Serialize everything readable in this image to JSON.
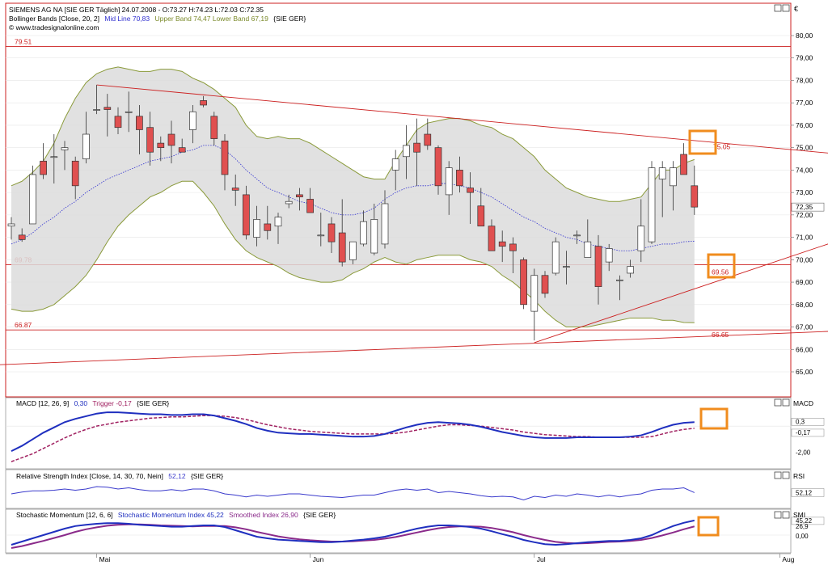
{
  "main": {
    "header_line1": "SIEMENS AG NA [SIE GER  Täglich] 24.07.2008 - O:73.27 H:74.23 L:72.03 C:72.35",
    "header_line2_a": "Bollinger Bands [Close, 20, 2]",
    "header_line2_b": "Mid Line 70,83",
    "header_line2_c": "Upper Band 74,47 Lower Band 67,19",
    "header_line2_d": "{SIE GER}",
    "source": "© www.tradesignalonline.com",
    "currency": "€",
    "y_ticks": [
      65,
      66,
      67,
      68,
      69,
      70,
      71,
      72,
      73,
      74,
      75,
      76,
      77,
      78,
      79,
      80
    ],
    "last_price": "72.35",
    "levels": [
      {
        "value": 79.51,
        "label": "79.51",
        "side": "left"
      },
      {
        "value": 69.78,
        "label": "69.78",
        "side": "left"
      },
      {
        "value": 66.87,
        "label": "66.87",
        "side": "left"
      }
    ],
    "trend_labels": [
      {
        "label": "75.05"
      },
      {
        "label": "69.56"
      },
      {
        "label": "66.65"
      }
    ]
  },
  "macd": {
    "title_a": "MACD [12, 26, 9]",
    "title_b": "0,30",
    "title_c": "Trigger -0,17",
    "title_d": "{SIE GER}",
    "axis_name": "MACD",
    "ticks": [
      "0,3",
      "-0,17",
      "-2,00"
    ]
  },
  "rsi": {
    "title_a": "Relative Strength Index [Close, 14, 30, 70, Nein]",
    "title_b": "52,12",
    "title_c": "{SIE GER}",
    "axis_name": "RSI",
    "tick": "52,12"
  },
  "smi": {
    "title_a": "Stochastic Momentum [12, 6, 6]",
    "title_b": "Stochastic Momentum Index 45,22",
    "title_c": "Smoothed Index 26,90",
    "title_d": "{SIE GER}",
    "axis_name": "SMI",
    "ticks": [
      "45,22",
      "26,9",
      "0,00"
    ]
  },
  "x_labels": [
    "Mai",
    "Jun",
    "Jul",
    "Aug"
  ],
  "colors": {
    "bull": "#ffffff",
    "bear": "#e05050",
    "band_fill": "#dcdcdc",
    "band_line": "#8a9a3a",
    "mid_line": "#3030d0",
    "level_line": "#cc2020",
    "highlight": "#f08c1e",
    "macd_line": "#1f2fbf",
    "trigger_line": "#a02060",
    "rsi_line": "#3a3acc",
    "smi_line": "#1f2fbf",
    "smi_smooth": "#8a2a8a"
  },
  "chart_data": {
    "type": "candlestick",
    "ylim": [
      64.3,
      80.9
    ],
    "candles": [
      {
        "o": 71.5,
        "h": 71.9,
        "l": 70.9,
        "c": 71.6
      },
      {
        "o": 71.1,
        "h": 71.4,
        "l": 70.8,
        "c": 70.9
      },
      {
        "o": 71.6,
        "h": 74.2,
        "l": 71.6,
        "c": 73.8
      },
      {
        "o": 74.4,
        "h": 75.2,
        "l": 73.6,
        "c": 73.8
      },
      {
        "o": 74.6,
        "h": 75.6,
        "l": 73.4,
        "c": 74.6
      },
      {
        "o": 74.9,
        "h": 75.3,
        "l": 74.0,
        "c": 75.0
      },
      {
        "o": 74.4,
        "h": 74.6,
        "l": 72.7,
        "c": 73.3
      },
      {
        "o": 74.5,
        "h": 76.6,
        "l": 74.3,
        "c": 75.6
      },
      {
        "o": 76.7,
        "h": 77.8,
        "l": 76.5,
        "c": 76.7
      },
      {
        "o": 76.8,
        "h": 77.4,
        "l": 75.5,
        "c": 76.7
      },
      {
        "o": 76.4,
        "h": 76.8,
        "l": 75.6,
        "c": 75.9
      },
      {
        "o": 76.6,
        "h": 77.5,
        "l": 75.7,
        "c": 76.6
      },
      {
        "o": 76.4,
        "h": 76.9,
        "l": 74.7,
        "c": 75.8
      },
      {
        "o": 75.9,
        "h": 76.6,
        "l": 74.2,
        "c": 74.8
      },
      {
        "o": 75.2,
        "h": 75.5,
        "l": 74.4,
        "c": 75.0
      },
      {
        "o": 75.6,
        "h": 76.2,
        "l": 74.3,
        "c": 75.1
      },
      {
        "o": 75.0,
        "h": 75.4,
        "l": 74.8,
        "c": 74.8
      },
      {
        "o": 75.8,
        "h": 76.9,
        "l": 75.2,
        "c": 76.6
      },
      {
        "o": 77.1,
        "h": 77.3,
        "l": 76.8,
        "c": 76.9
      },
      {
        "o": 76.4,
        "h": 76.6,
        "l": 75.1,
        "c": 75.4
      },
      {
        "o": 75.3,
        "h": 75.6,
        "l": 73.1,
        "c": 73.8
      },
      {
        "o": 73.2,
        "h": 73.8,
        "l": 72.4,
        "c": 73.1
      },
      {
        "o": 72.9,
        "h": 73.3,
        "l": 70.9,
        "c": 71.1
      },
      {
        "o": 71.0,
        "h": 72.4,
        "l": 70.6,
        "c": 71.8
      },
      {
        "o": 71.6,
        "h": 72.4,
        "l": 70.9,
        "c": 71.3
      },
      {
        "o": 71.5,
        "h": 72.1,
        "l": 70.7,
        "c": 71.9
      },
      {
        "o": 72.5,
        "h": 72.9,
        "l": 72.3,
        "c": 72.6
      },
      {
        "o": 72.9,
        "h": 73.2,
        "l": 72.2,
        "c": 72.8
      },
      {
        "o": 72.7,
        "h": 73.2,
        "l": 72.5,
        "c": 72.1
      },
      {
        "o": 71.1,
        "h": 72.1,
        "l": 70.6,
        "c": 71.1
      },
      {
        "o": 71.6,
        "h": 71.9,
        "l": 70.3,
        "c": 70.8
      },
      {
        "o": 71.2,
        "h": 72.7,
        "l": 69.7,
        "c": 69.9
      },
      {
        "o": 70.0,
        "h": 70.8,
        "l": 69.8,
        "c": 70.8
      },
      {
        "o": 70.7,
        "h": 72.2,
        "l": 70.6,
        "c": 71.7
      },
      {
        "o": 70.3,
        "h": 72.5,
        "l": 70.2,
        "c": 71.8
      },
      {
        "o": 70.7,
        "h": 73.1,
        "l": 70.5,
        "c": 72.5
      },
      {
        "o": 74.0,
        "h": 74.9,
        "l": 73.1,
        "c": 74.5
      },
      {
        "o": 74.6,
        "h": 76.0,
        "l": 73.6,
        "c": 75.1
      },
      {
        "o": 75.2,
        "h": 76.3,
        "l": 73.3,
        "c": 74.8
      },
      {
        "o": 75.6,
        "h": 76.3,
        "l": 74.9,
        "c": 75.1
      },
      {
        "o": 75.0,
        "h": 75.1,
        "l": 72.9,
        "c": 73.3
      },
      {
        "o": 72.9,
        "h": 74.4,
        "l": 72.0,
        "c": 74.1
      },
      {
        "o": 74.0,
        "h": 74.6,
        "l": 73.0,
        "c": 73.3
      },
      {
        "o": 73.2,
        "h": 73.9,
        "l": 71.6,
        "c": 73.0
      },
      {
        "o": 72.4,
        "h": 73.2,
        "l": 71.5,
        "c": 71.5
      },
      {
        "o": 71.5,
        "h": 71.8,
        "l": 70.4,
        "c": 70.4
      },
      {
        "o": 70.8,
        "h": 71.3,
        "l": 69.9,
        "c": 70.6
      },
      {
        "o": 70.7,
        "h": 71.0,
        "l": 69.4,
        "c": 70.4
      },
      {
        "o": 70.0,
        "h": 70.1,
        "l": 67.8,
        "c": 68.0
      },
      {
        "o": 67.7,
        "h": 69.6,
        "l": 66.4,
        "c": 69.3
      },
      {
        "o": 69.3,
        "h": 69.5,
        "l": 68.3,
        "c": 68.5
      },
      {
        "o": 69.4,
        "h": 71.0,
        "l": 69.3,
        "c": 70.8
      },
      {
        "o": 69.7,
        "h": 70.4,
        "l": 68.9,
        "c": 69.7
      },
      {
        "o": 71.1,
        "h": 71.3,
        "l": 70.7,
        "c": 71.1
      },
      {
        "o": 70.1,
        "h": 71.8,
        "l": 70.1,
        "c": 70.8
      },
      {
        "o": 70.6,
        "h": 71.1,
        "l": 68.0,
        "c": 68.8
      },
      {
        "o": 69.9,
        "h": 70.7,
        "l": 69.5,
        "c": 70.5
      },
      {
        "o": 69.1,
        "h": 69.3,
        "l": 68.2,
        "c": 69.1
      },
      {
        "o": 69.4,
        "h": 70.0,
        "l": 69.2,
        "c": 69.7
      },
      {
        "o": 70.4,
        "h": 72.7,
        "l": 69.9,
        "c": 71.5
      },
      {
        "o": 70.8,
        "h": 74.4,
        "l": 70.7,
        "c": 74.1
      },
      {
        "o": 73.6,
        "h": 74.4,
        "l": 71.9,
        "c": 74.1
      },
      {
        "o": 73.3,
        "h": 74.4,
        "l": 72.2,
        "c": 74.1
      },
      {
        "o": 74.7,
        "h": 75.2,
        "l": 73.9,
        "c": 73.8
      },
      {
        "o": 73.3,
        "h": 74.2,
        "l": 72.0,
        "c": 72.35
      }
    ],
    "bollinger_upper": [
      73.3,
      73.5,
      73.9,
      74.4,
      75.2,
      76.3,
      77.2,
      77.9,
      78.3,
      78.5,
      78.6,
      78.5,
      78.4,
      78.4,
      78.5,
      78.5,
      78.4,
      78.1,
      77.9,
      77.6,
      77.2,
      76.8,
      76.0,
      75.5,
      75.4,
      75.5,
      75.4,
      75.4,
      75.2,
      74.9,
      74.6,
      74.3,
      74.0,
      73.7,
      73.6,
      73.6,
      74.4,
      75.1,
      75.8,
      76.1,
      76.2,
      76.3,
      76.3,
      76.2,
      76.0,
      75.9,
      75.6,
      75.4,
      75.0,
      74.6,
      74.0,
      73.6,
      73.2,
      73.0,
      72.8,
      72.7,
      72.6,
      72.6,
      72.7,
      72.8,
      73.4,
      74.0,
      74.0,
      74.3,
      74.47
    ],
    "bollinger_mid": [
      70.7,
      70.9,
      71.2,
      71.6,
      71.9,
      72.3,
      72.6,
      73.0,
      73.3,
      73.6,
      73.8,
      74.0,
      74.2,
      74.4,
      74.5,
      74.6,
      74.8,
      74.9,
      75.1,
      75.1,
      74.9,
      74.5,
      74.0,
      73.6,
      73.2,
      73.0,
      72.8,
      72.6,
      72.5,
      72.3,
      72.1,
      72.0,
      72.0,
      72.1,
      72.3,
      72.7,
      73.0,
      73.2,
      73.3,
      73.3,
      73.4,
      73.4,
      73.3,
      73.2,
      73.0,
      72.8,
      72.5,
      72.2,
      71.9,
      71.7,
      71.4,
      71.2,
      71.0,
      70.9,
      70.7,
      70.6,
      70.5,
      70.4,
      70.4,
      70.5,
      70.6,
      70.7,
      70.7,
      70.8,
      70.83
    ],
    "bollinger_lower": [
      67.8,
      67.7,
      67.7,
      67.8,
      68.0,
      68.4,
      68.8,
      69.3,
      70.0,
      70.8,
      71.5,
      72.0,
      72.4,
      72.8,
      73.0,
      73.3,
      73.5,
      73.5,
      73.0,
      72.4,
      71.6,
      70.9,
      70.4,
      70.1,
      69.9,
      69.7,
      69.4,
      69.2,
      69.1,
      69.0,
      69.0,
      69.1,
      69.4,
      69.6,
      69.9,
      70.1,
      69.9,
      69.8,
      70.0,
      70.1,
      70.2,
      70.2,
      70.2,
      70.0,
      69.9,
      69.7,
      69.3,
      69.0,
      68.6,
      68.2,
      67.7,
      67.3,
      67.0,
      67.0,
      67.0,
      67.1,
      67.2,
      67.3,
      67.4,
      67.4,
      67.4,
      67.3,
      67.3,
      67.2,
      67.19
    ],
    "macd": [
      -1.9,
      -1.5,
      -1.0,
      -0.5,
      -0.1,
      0.3,
      0.55,
      0.75,
      0.95,
      1.05,
      1.05,
      1.0,
      0.95,
      0.9,
      0.9,
      0.85,
      0.85,
      0.9,
      0.9,
      0.8,
      0.6,
      0.4,
      0.15,
      -0.15,
      -0.35,
      -0.5,
      -0.55,
      -0.6,
      -0.6,
      -0.65,
      -0.7,
      -0.75,
      -0.8,
      -0.8,
      -0.75,
      -0.6,
      -0.35,
      -0.1,
      0.1,
      0.25,
      0.3,
      0.25,
      0.2,
      0.1,
      -0.05,
      -0.25,
      -0.45,
      -0.6,
      -0.75,
      -0.85,
      -0.9,
      -0.9,
      -0.9,
      -0.85,
      -0.85,
      -0.85,
      -0.85,
      -0.85,
      -0.8,
      -0.7,
      -0.45,
      -0.15,
      0.1,
      0.25,
      0.3
    ],
    "macd_trigger": [
      -2.7,
      -2.4,
      -2.1,
      -1.7,
      -1.3,
      -0.9,
      -0.55,
      -0.25,
      0.0,
      0.15,
      0.3,
      0.4,
      0.5,
      0.6,
      0.65,
      0.7,
      0.7,
      0.75,
      0.8,
      0.8,
      0.75,
      0.65,
      0.5,
      0.3,
      0.1,
      -0.05,
      -0.2,
      -0.3,
      -0.4,
      -0.45,
      -0.5,
      -0.55,
      -0.6,
      -0.6,
      -0.6,
      -0.6,
      -0.55,
      -0.45,
      -0.3,
      -0.15,
      0.0,
      0.1,
      0.1,
      0.05,
      0.0,
      -0.1,
      -0.2,
      -0.3,
      -0.45,
      -0.55,
      -0.65,
      -0.7,
      -0.75,
      -0.8,
      -0.8,
      -0.85,
      -0.85,
      -0.85,
      -0.85,
      -0.85,
      -0.8,
      -0.6,
      -0.4,
      -0.25,
      -0.17
    ],
    "rsi": [
      50,
      53,
      55,
      55,
      56,
      58,
      56,
      58,
      62,
      61,
      58,
      60,
      57,
      55,
      55,
      57,
      55,
      58,
      58,
      55,
      50,
      48,
      45,
      48,
      46,
      48,
      50,
      50,
      48,
      46,
      45,
      44,
      46,
      48,
      48,
      52,
      56,
      58,
      56,
      58,
      52,
      54,
      52,
      50,
      47,
      45,
      46,
      45,
      40,
      46,
      44,
      48,
      46,
      50,
      48,
      45,
      48,
      45,
      48,
      50,
      56,
      58,
      58,
      60,
      52.12
    ],
    "smi": [
      -30,
      -20,
      -10,
      0,
      10,
      20,
      28,
      32,
      35,
      37,
      37,
      35,
      32,
      30,
      28,
      26,
      26,
      28,
      30,
      30,
      25,
      15,
      5,
      -5,
      -10,
      -14,
      -16,
      -18,
      -20,
      -22,
      -22,
      -20,
      -17,
      -14,
      -10,
      -5,
      3,
      12,
      20,
      26,
      30,
      30,
      28,
      25,
      20,
      12,
      3,
      -5,
      -15,
      -22,
      -28,
      -30,
      -28,
      -25,
      -22,
      -20,
      -18,
      -18,
      -15,
      -10,
      0,
      15,
      28,
      38,
      45.22
    ],
    "smi_smooth": [
      -40,
      -34,
      -26,
      -18,
      -9,
      0,
      10,
      18,
      24,
      29,
      32,
      33,
      33,
      32,
      30,
      29,
      28,
      27,
      28,
      28,
      28,
      24,
      18,
      10,
      3,
      -4,
      -9,
      -13,
      -16,
      -18,
      -20,
      -20,
      -19,
      -17,
      -15,
      -11,
      -6,
      1,
      8,
      15,
      21,
      25,
      27,
      27,
      26,
      22,
      16,
      9,
      0,
      -8,
      -15,
      -21,
      -24,
      -26,
      -25,
      -23,
      -21,
      -20,
      -18,
      -15,
      -9,
      -1,
      8,
      18,
      26.9
    ],
    "trendlines": [
      {
        "name": "resistance",
        "from": {
          "i": 8,
          "v": 77.8
        },
        "to": {
          "i": 79,
          "v": 74.65
        }
      },
      {
        "name": "support",
        "from": {
          "i": 49,
          "v": 66.3
        },
        "to": {
          "i": 79,
          "v": 71.1
        }
      },
      {
        "name": "long-support",
        "from": {
          "i": -2,
          "v": 65.3
        },
        "to": {
          "i": 79,
          "v": 66.85
        }
      }
    ]
  }
}
